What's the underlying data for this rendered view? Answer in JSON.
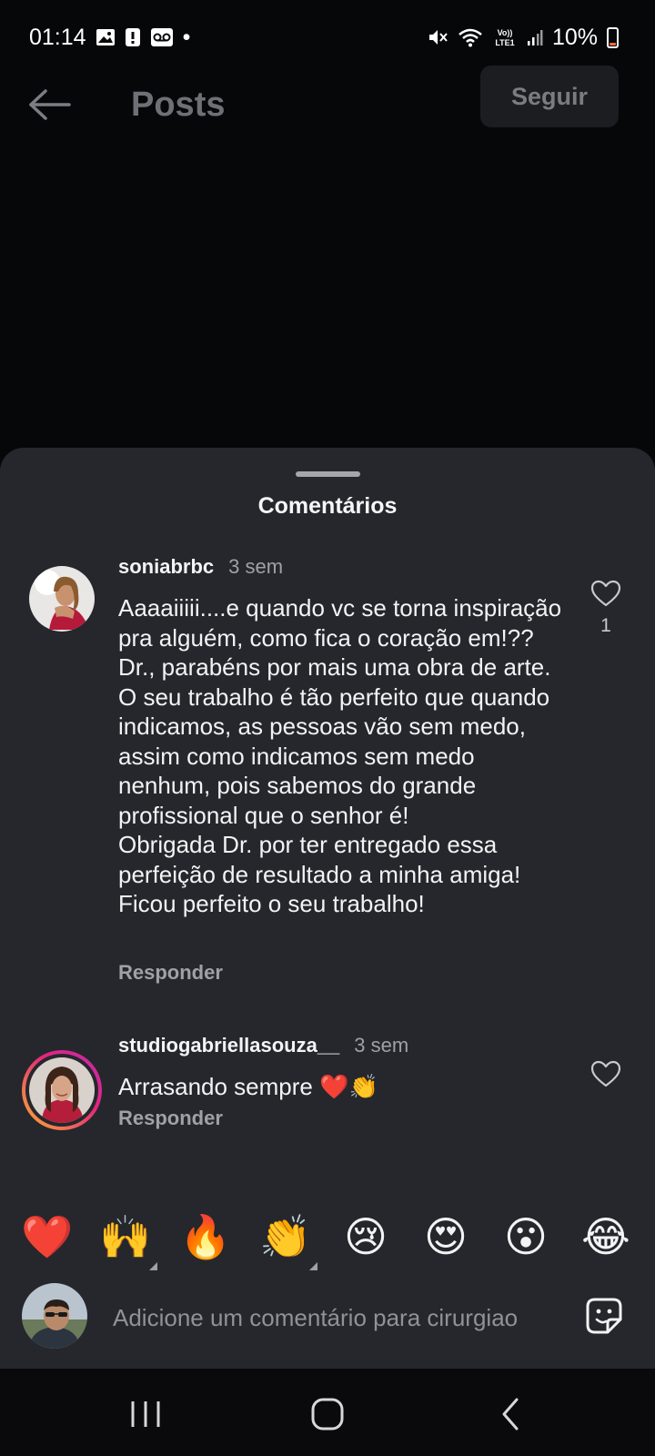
{
  "status_bar": {
    "time": "01:14",
    "dot": "•",
    "battery_percent": "10%",
    "icons": [
      "gallery-icon",
      "alert-icon",
      "voicemail-icon",
      "mute-icon",
      "wifi-icon",
      "volte-icon",
      "signal-icon",
      "battery-icon"
    ],
    "volte_label": "Vo)) LTE1"
  },
  "header": {
    "title": "Posts",
    "follow_label": "Seguir"
  },
  "comments_sheet": {
    "title": "Comentários",
    "comments": [
      {
        "username": "soniabrbc",
        "time": "3 sem",
        "text": "Aaaaiiiii....e quando vc se torna inspiração pra alguém, como fica o coração em!??\nDr., parabéns por mais uma obra de arte.\nO seu trabalho é tão perfeito que quando indicamos, as pessoas vão sem medo, assim como indicamos sem medo nenhum, pois sabemos do grande profissional que o senhor é!\nObrigada Dr. por ter entregado essa perfeição de resultado a minha amiga! Ficou perfeito o seu trabalho!",
        "reply_label": "Responder",
        "likes": "1"
      },
      {
        "username": "studiogabriellasouza__",
        "time": "3 sem",
        "text": "Arrasando sempre ❤️👏",
        "reply_label": "Responder"
      }
    ],
    "quick_reactions": [
      "❤️",
      "🙌",
      "🔥",
      "👏",
      "😢",
      "😍",
      "😮",
      "😂"
    ],
    "input_placeholder": "Adicione um comentário para cirurgiao"
  },
  "colors": {
    "background": "#060709",
    "sheet": "#25272c",
    "muted_text": "#9ea1a7",
    "story_ring": [
      "#f9b233",
      "#e4267a",
      "#c229b2"
    ]
  }
}
